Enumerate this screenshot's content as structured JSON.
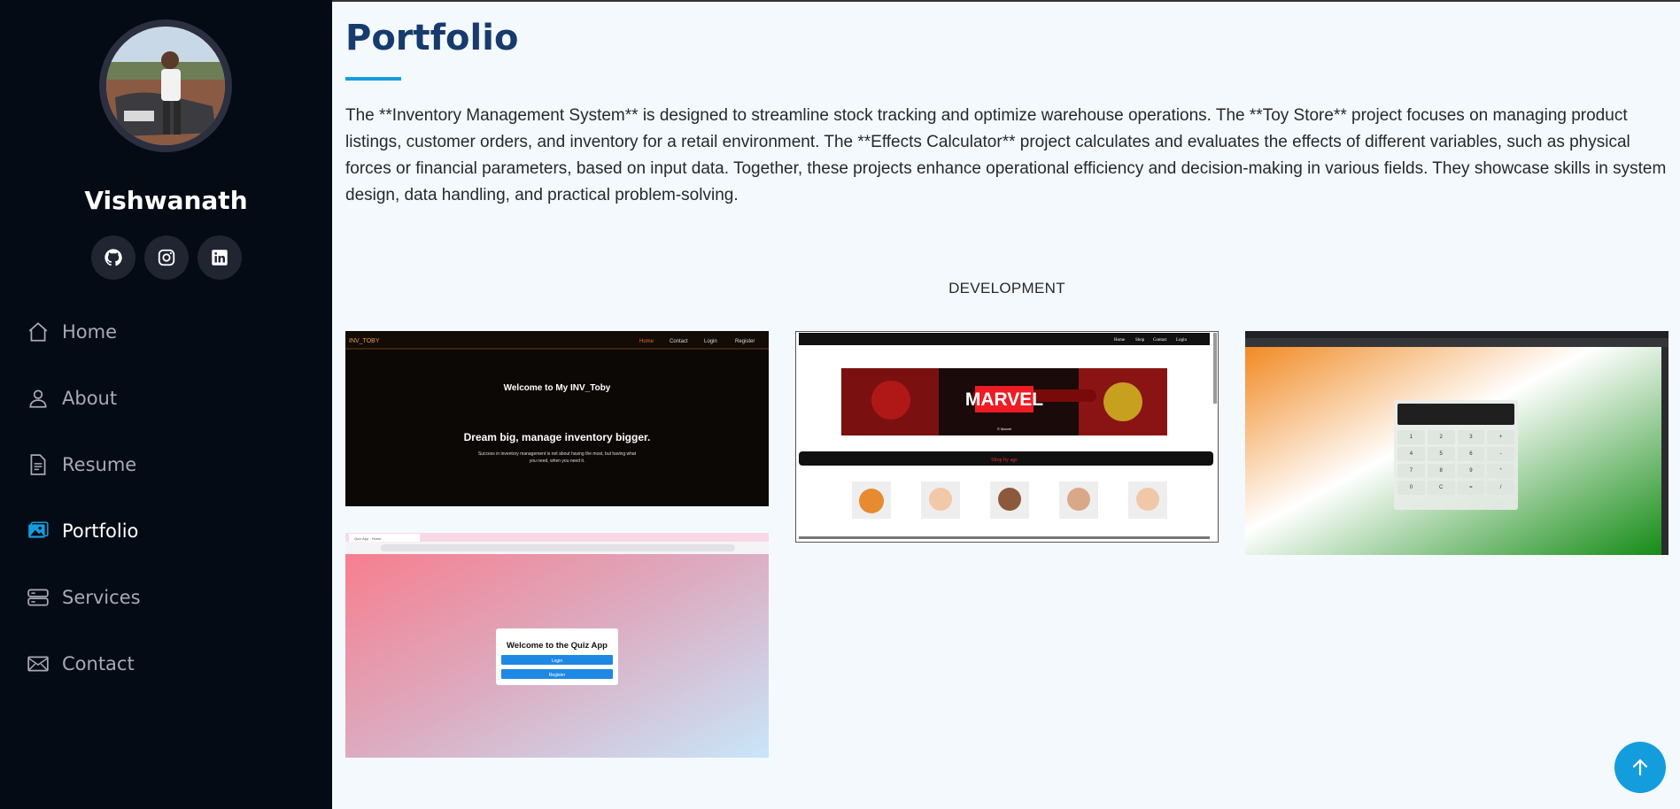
{
  "profile": {
    "name": "Vishwanath"
  },
  "socials": [
    {
      "icon": "github-icon"
    },
    {
      "icon": "instagram-icon"
    },
    {
      "icon": "linkedin-icon"
    }
  ],
  "nav": {
    "items": [
      {
        "label": "Home",
        "icon": "home-icon"
      },
      {
        "label": "About",
        "icon": "person-icon"
      },
      {
        "label": "Resume",
        "icon": "file-text-icon"
      },
      {
        "label": "Portfolio",
        "icon": "images-icon",
        "active": true
      },
      {
        "label": "Services",
        "icon": "server-icon"
      },
      {
        "label": "Contact",
        "icon": "envelope-icon"
      }
    ]
  },
  "main": {
    "title": "Portfolio",
    "intro": "The **Inventory Management System** is designed to streamline stock tracking and optimize warehouse operations. The **Toy Store** project focuses on managing product listings, customer orders, and inventory for a retail environment. The **Effects Calculator** project calculates and evaluates the effects of different variables, such as physical forces or financial parameters, based on input data. Together, these projects enhance operational efficiency and decision-making in various fields. They showcase skills in system design, data handling, and practical problem-solving.",
    "filter": "DEVELOPMENT"
  },
  "portfolio": {
    "inventory": {
      "brand": "INV_TOBY",
      "nav": [
        "Home",
        "Contact",
        "Login",
        "Register"
      ],
      "welcome": "Welcome to My INV_Toby",
      "headline": "Dream big, manage inventory bigger.",
      "sub1": "Success in inventory management is not about having the most, but having what",
      "sub2": "you need, when you need it."
    },
    "toystore": {
      "nav": [
        "Home",
        "Shop",
        "Contact",
        "Login"
      ],
      "banner": "MARVEL",
      "banner_sub": "© Marvel",
      "cta": "Shop by age"
    },
    "calculator": {
      "keys": [
        "1",
        "2",
        "3",
        "+",
        "4",
        "5",
        "6",
        "-",
        "7",
        "8",
        "9",
        "*",
        "0",
        "C",
        "=",
        "/"
      ]
    },
    "quiz": {
      "title": "Welcome to the Quiz App",
      "login": "Login",
      "register": "Register",
      "tab": "Quiz App - Home"
    }
  },
  "colors": {
    "accent": "#149ddd",
    "sidebar": "#040b14",
    "title": "#173b6c"
  }
}
